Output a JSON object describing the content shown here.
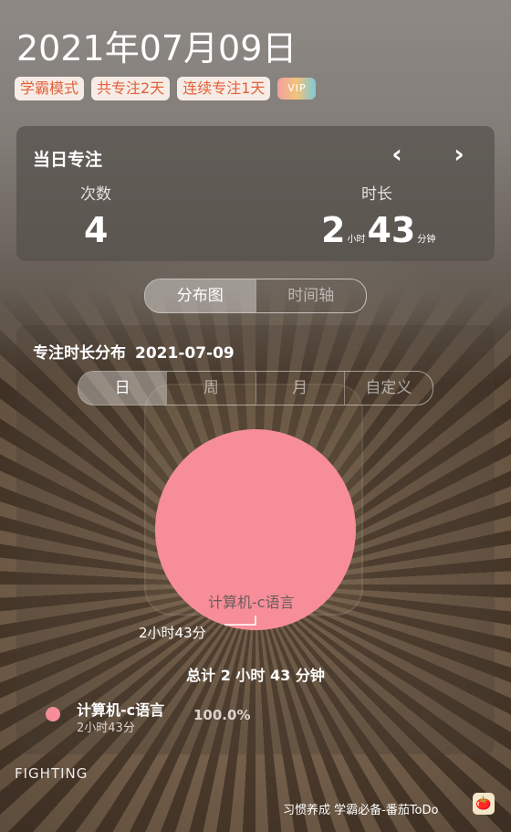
{
  "header": {
    "date": "2021年07月09日",
    "tags": [
      "学霸模式",
      "共专注2天",
      "连续专注1天"
    ],
    "vip": "VIP"
  },
  "daily": {
    "title": "当日专注",
    "prev_icon": "chevron-left-icon",
    "next_icon": "chevron-right-icon",
    "count_label": "次数",
    "count": "4",
    "duration_label": "时长",
    "hours": "2",
    "hours_unit": "小时",
    "minutes": "43",
    "minutes_unit": "分钟"
  },
  "view_toggle": {
    "active": "分布图",
    "inactive": "时间轴"
  },
  "distribution": {
    "title": "专注时长分布",
    "date": "2021-07-09",
    "segments": [
      "日",
      "周",
      "月",
      "自定义"
    ],
    "active_segment": "日",
    "total": "总计 2 小时 43 分钟"
  },
  "chart_data": {
    "type": "pie",
    "series": [
      {
        "name": "计算机-c语言",
        "value_label": "2小时43分",
        "percent": 100.0,
        "color": "#f78d99"
      }
    ]
  },
  "legend": {
    "name": "计算机-c语言",
    "duration": "2小时43分",
    "percent": "100.0%"
  },
  "footer": {
    "motto": "FIGHTING",
    "slogan": "习惯养成 学霸必备-番茄ToDo",
    "app_icon": "tomato-icon"
  },
  "colors": {
    "accent": "#e2603a",
    "pie": "#f78d99"
  }
}
